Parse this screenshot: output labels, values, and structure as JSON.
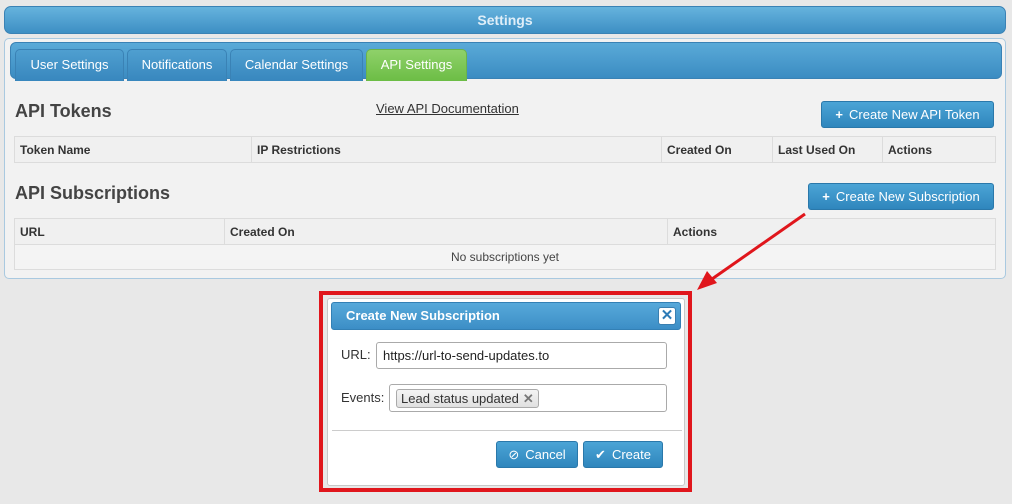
{
  "header": {
    "title": "Settings"
  },
  "tabs": [
    {
      "label": "User Settings"
    },
    {
      "label": "Notifications"
    },
    {
      "label": "Calendar Settings"
    },
    {
      "label": "API Settings",
      "active": true
    }
  ],
  "tokens": {
    "title": "API Tokens",
    "doc_link": "View API Documentation",
    "create_label": "Create New API Token",
    "columns": [
      "Token Name",
      "IP Restrictions",
      "Created On",
      "Last Used On",
      "Actions"
    ]
  },
  "subscriptions": {
    "title": "API Subscriptions",
    "create_label": "Create New Subscription",
    "columns": [
      "URL",
      "Created On",
      "Actions"
    ],
    "empty_text": "No subscriptions yet"
  },
  "dialog": {
    "title": "Create New Subscription",
    "close_icon": "close-icon",
    "url_label": "URL:",
    "url_value": "https://url-to-send-updates.to",
    "events_label": "Events:",
    "events": [
      "Lead status updated"
    ],
    "cancel_label": "Cancel",
    "create_label": "Create"
  },
  "colors": {
    "accent": "#3d8fc4",
    "active_tab": "#6cbd45",
    "highlight": "#e0161c"
  }
}
